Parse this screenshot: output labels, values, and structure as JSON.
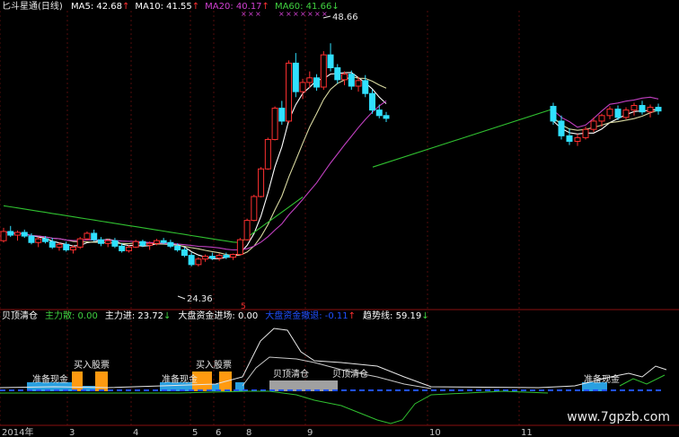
{
  "header": {
    "title": "匕斗星通(日线)",
    "ma": [
      {
        "label": "MA5: 42.68",
        "arrow": "↑",
        "color": "#ffffff",
        "arrow_color": "#ff3030"
      },
      {
        "label": "MA10: 41.55",
        "arrow": "↑",
        "color": "#ffffff",
        "arrow_color": "#ff3030"
      },
      {
        "label": "MA20: 40.17",
        "arrow": "↑",
        "color": "#d040d0",
        "arrow_color": "#ff3030"
      },
      {
        "label": "MA60: 41.66",
        "arrow": "↓",
        "color": "#40d040",
        "arrow_color": "#40d040"
      }
    ]
  },
  "indicator_header": {
    "items": [
      {
        "label": "贝顶清仓",
        "color": "#ffffff"
      },
      {
        "label": "主力散: 0.00",
        "color": "#40d040"
      },
      {
        "label": "主力进: 23.72",
        "arrow": "↓",
        "color": "#ffffff",
        "arrow_color": "#40d040"
      },
      {
        "label": "大盘资金进场: 0.00",
        "color": "#ffffff"
      },
      {
        "label": "大盘资金撤退: -0.11",
        "arrow": "↑",
        "color": "#2050ff",
        "arrow_color": "#ff3030"
      },
      {
        "label": "趋势线: 59.19",
        "arrow": "↓",
        "color": "#ffffff",
        "arrow_color": "#40d040"
      }
    ]
  },
  "chart_data": {
    "type": "candlestick",
    "price_high_label": "48.66",
    "price_low_label": "24.36",
    "right_marker": "5",
    "x_axis_labels": [
      "2014年",
      "3",
      "4",
      "5",
      "6",
      "8",
      "9",
      "10",
      "11"
    ],
    "price_range": [
      20,
      52
    ],
    "candles": [
      [
        27.2,
        28.6,
        27.0,
        28.2
      ],
      [
        28.2,
        28.8,
        27.6,
        27.8
      ],
      [
        27.8,
        28.3,
        27.2,
        28.1
      ],
      [
        28.1,
        28.4,
        27.5,
        27.7
      ],
      [
        27.7,
        28.0,
        26.8,
        27.0
      ],
      [
        27.0,
        27.6,
        26.5,
        27.4
      ],
      [
        27.4,
        27.7,
        26.9,
        27.1
      ],
      [
        27.1,
        27.5,
        26.3,
        26.5
      ],
      [
        26.5,
        27.0,
        26.1,
        26.8
      ],
      [
        26.8,
        27.1,
        26.0,
        26.2
      ],
      [
        26.2,
        26.7,
        25.8,
        26.5
      ],
      [
        26.5,
        27.6,
        26.3,
        27.4
      ],
      [
        27.4,
        28.2,
        27.2,
        28.0
      ],
      [
        28.0,
        28.4,
        27.1,
        27.3
      ],
      [
        27.3,
        27.6,
        26.6,
        26.9
      ],
      [
        26.9,
        27.4,
        26.5,
        27.2
      ],
      [
        27.2,
        27.5,
        26.4,
        26.6
      ],
      [
        26.6,
        26.9,
        25.9,
        26.1
      ],
      [
        26.1,
        26.7,
        25.9,
        26.5
      ],
      [
        26.5,
        27.3,
        26.4,
        27.1
      ],
      [
        27.1,
        27.3,
        26.5,
        26.7
      ],
      [
        26.7,
        27.1,
        26.2,
        26.9
      ],
      [
        26.9,
        27.4,
        26.7,
        27.2
      ],
      [
        27.2,
        27.5,
        26.8,
        27.0
      ],
      [
        27.0,
        27.3,
        26.4,
        26.6
      ],
      [
        26.6,
        26.9,
        26.0,
        26.2
      ],
      [
        26.2,
        26.5,
        25.4,
        25.6
      ],
      [
        25.6,
        25.9,
        24.4,
        24.6
      ],
      [
        24.6,
        25.4,
        24.4,
        25.2
      ],
      [
        25.2,
        25.7,
        24.9,
        25.5
      ],
      [
        25.5,
        25.9,
        25.1,
        25.3
      ],
      [
        25.3,
        25.8,
        25.0,
        25.6
      ],
      [
        25.6,
        25.9,
        25.2,
        25.4
      ],
      [
        25.4,
        25.8,
        25.1,
        25.7
      ],
      [
        25.7,
        27.5,
        25.6,
        27.3
      ],
      [
        27.3,
        29.6,
        27.2,
        29.4
      ],
      [
        29.4,
        32.2,
        29.3,
        32.0
      ],
      [
        32.0,
        35.2,
        31.9,
        35.0
      ],
      [
        35.0,
        38.4,
        34.9,
        38.2
      ],
      [
        38.2,
        41.8,
        38.1,
        41.6
      ],
      [
        41.6,
        42.4,
        39.8,
        40.2
      ],
      [
        40.2,
        46.8,
        40.0,
        46.5
      ],
      [
        46.5,
        47.6,
        42.8,
        43.4
      ],
      [
        43.4,
        44.8,
        42.6,
        44.4
      ],
      [
        44.4,
        45.6,
        43.8,
        44.9
      ],
      [
        44.9,
        45.3,
        43.5,
        43.9
      ],
      [
        43.9,
        47.8,
        43.6,
        47.4
      ],
      [
        47.4,
        48.66,
        45.6,
        46.0
      ],
      [
        46.0,
        46.4,
        44.3,
        44.7
      ],
      [
        44.7,
        45.6,
        44.1,
        45.3
      ],
      [
        45.3,
        45.7,
        43.6,
        44.0
      ],
      [
        44.0,
        45.0,
        43.4,
        44.6
      ],
      [
        44.6,
        45.2,
        42.8,
        43.2
      ],
      [
        43.2,
        43.6,
        41.0,
        41.4
      ],
      [
        41.4,
        42.0,
        40.5,
        40.8
      ],
      [
        40.8,
        41.2,
        40.1,
        40.5
      ]
    ],
    "right_candles": [
      [
        41.8,
        42.2,
        39.8,
        40.2
      ],
      [
        40.2,
        40.8,
        38.2,
        38.6
      ],
      [
        38.6,
        39.4,
        37.6,
        38.0
      ],
      [
        38.0,
        38.8,
        37.5,
        38.4
      ],
      [
        38.4,
        39.6,
        38.2,
        39.3
      ],
      [
        39.3,
        40.6,
        39.0,
        40.2
      ],
      [
        40.2,
        41.0,
        39.6,
        40.8
      ],
      [
        40.8,
        41.8,
        40.4,
        41.5
      ],
      [
        41.5,
        41.9,
        40.3,
        40.6
      ],
      [
        40.6,
        41.7,
        40.4,
        41.4
      ],
      [
        41.4,
        42.2,
        40.8,
        41.9
      ],
      [
        41.9,
        42.4,
        40.9,
        41.2
      ],
      [
        41.2,
        42.0,
        40.6,
        41.7
      ],
      [
        41.7,
        42.1,
        40.9,
        41.3
      ]
    ],
    "annotations": [
      "准备现金",
      "买入股票",
      "准备现金",
      "买入股票",
      "贝顶清仓",
      "贝顶清仓",
      "准备现金"
    ]
  },
  "watermark": "www.7gpzb.com"
}
